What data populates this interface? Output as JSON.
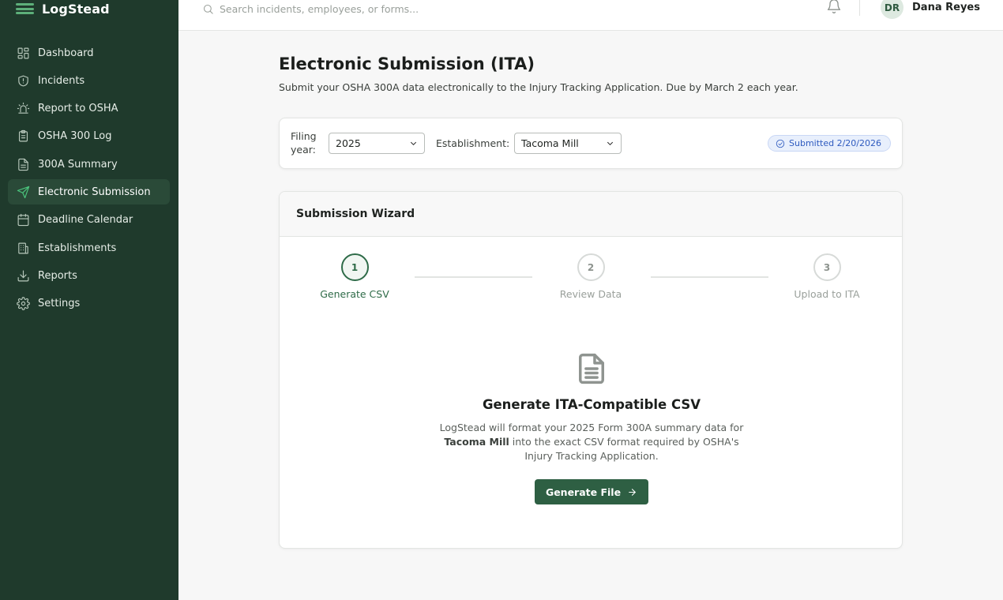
{
  "app": {
    "name": "LogStead"
  },
  "topbar": {
    "search_placeholder": "Search incidents, employees, or forms...",
    "user": {
      "initials": "DR",
      "name": "Dana Reyes"
    }
  },
  "sidebar": {
    "items": [
      {
        "label": "Dashboard",
        "icon": "dashboard-icon"
      },
      {
        "label": "Incidents",
        "icon": "shield-alert-icon"
      },
      {
        "label": "Report to OSHA",
        "icon": "siren-icon"
      },
      {
        "label": "OSHA 300 Log",
        "icon": "clipboard-icon"
      },
      {
        "label": "300A Summary",
        "icon": "file-text-icon"
      },
      {
        "label": "Electronic Submission",
        "icon": "send-icon",
        "active": true
      },
      {
        "label": "Deadline Calendar",
        "icon": "calendar-icon"
      },
      {
        "label": "Establishments",
        "icon": "building-icon"
      },
      {
        "label": "Reports",
        "icon": "download-icon"
      },
      {
        "label": "Settings",
        "icon": "gear-icon"
      }
    ]
  },
  "page": {
    "title": "Electronic Submission (ITA)",
    "subtitle": "Submit your OSHA 300A data electronically to the Injury Tracking Application. Due by March 2 each year."
  },
  "filters": {
    "year_label": "Filing year:",
    "year_value": "2025",
    "establishment_label": "Establishment:",
    "establishment_value": "Tacoma Mill",
    "status_badge": "Submitted 2/20/2026"
  },
  "wizard": {
    "title": "Submission Wizard",
    "steps": [
      {
        "number": "1",
        "label": "Generate CSV",
        "active": true
      },
      {
        "number": "2",
        "label": "Review Data"
      },
      {
        "number": "3",
        "label": "Upload to ITA"
      }
    ],
    "content": {
      "heading": "Generate ITA-Compatible CSV",
      "desc_before": "LogStead will format your 2025 Form 300A summary data for ",
      "desc_bold": "Tacoma Mill",
      "desc_after": " into the exact CSV format required by OSHA's Injury Tracking Application.",
      "button_label": "Generate File"
    }
  },
  "colors": {
    "sidebar_bg": "#1f3a2c",
    "accent": "#2e5f43",
    "active_icon": "#4cc77e",
    "badge_blue": "#2f5bbf"
  }
}
